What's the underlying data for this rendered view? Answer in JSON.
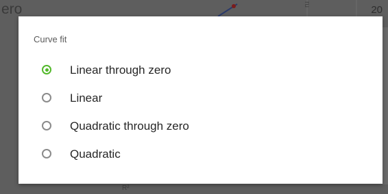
{
  "background": {
    "title_fragment": "ero",
    "number_fragment": "20",
    "vertical_fragment": "ru",
    "r2_label": "R²"
  },
  "dialog": {
    "title": "Curve fit",
    "accent_color": "#52b82a",
    "selected_index": 0,
    "options": [
      {
        "label": "Linear through zero",
        "checked": true
      },
      {
        "label": "Linear",
        "checked": false
      },
      {
        "label": "Quadratic through zero",
        "checked": false
      },
      {
        "label": "Quadratic",
        "checked": false
      }
    ]
  }
}
